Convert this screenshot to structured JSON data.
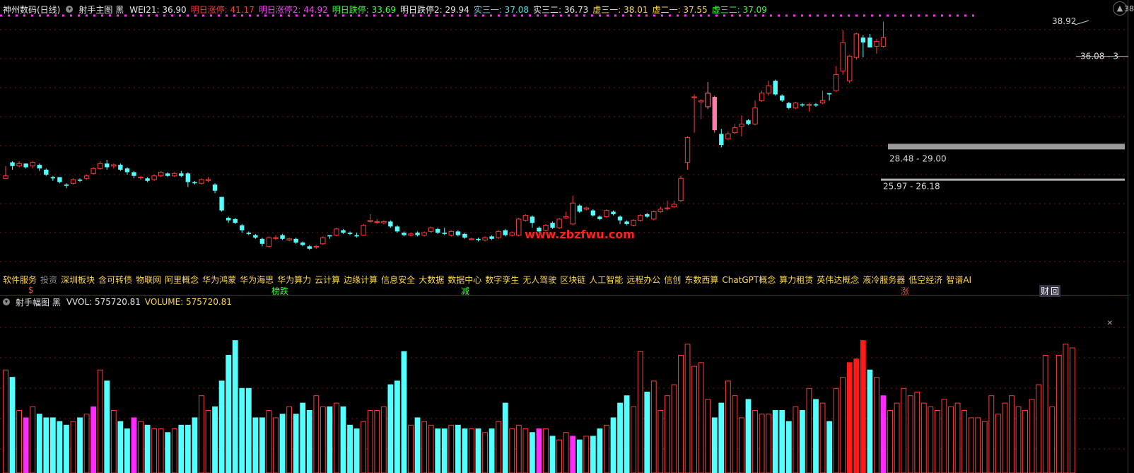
{
  "header": {
    "stock": "神州数码(日线)",
    "indicator": "射手主图 黑",
    "fields": [
      {
        "label": "WEI21: ",
        "value": "36.90",
        "color": "#e8e8e8"
      },
      {
        "label": "明日涨停: ",
        "value": "41.17",
        "color": "#ff3b3b"
      },
      {
        "label": "明日涨停2: ",
        "value": "44.92",
        "color": "#ff3bff"
      },
      {
        "label": "明日跌停: ",
        "value": "33.69",
        "color": "#3bff3b"
      },
      {
        "label": "明日跌停2: ",
        "value": "29.94",
        "color": "#e8e8e8"
      },
      {
        "label": "实三一: ",
        "value": "37.08",
        "color": "#4de0e0"
      },
      {
        "label": "实三二: ",
        "value": "36.73",
        "color": "#e8e8e8"
      },
      {
        "label": "虚三一: ",
        "value": "38.01",
        "color": "#ffd84a"
      },
      {
        "label": "虚二一: ",
        "value": "37.55",
        "color": "#ffd84a"
      },
      {
        "label": "虚三二: ",
        "value": "37.09",
        "color": "#3bff3b"
      }
    ]
  },
  "sub_header": {
    "indicator": "射手幅图 黑",
    "fields": [
      {
        "label": "VVOL: ",
        "value": "575720.81",
        "color": "#e8e8e8"
      },
      {
        "label": "VOLUME: ",
        "value": "575720.81",
        "color": "#ffd84a"
      }
    ]
  },
  "right_axis_label": "38",
  "price_labels": {
    "high": "38.92",
    "last": "36.08 - 3",
    "zone1": "28.48 - 29.00",
    "zone2": "25.97 - 26.18"
  },
  "watermark": "www.zbzfwu.com",
  "concepts": [
    "软件服务",
    "投资",
    "深圳板块",
    "含可转债",
    "物联网",
    "阿里概念",
    "华为鸿蒙",
    "华为海思",
    "华为算力",
    "云计算",
    "边缘计算",
    "信息安全",
    "大数据",
    "数据中心",
    "数字孪生",
    "无人驾驶",
    "区块链",
    "人工智能",
    "远程办公",
    "信创",
    "东数西算",
    "ChatGPT概念",
    "算力租赁",
    "英伟达概念",
    "液冷服务器",
    "低空经济",
    "智谱AI"
  ],
  "events": [
    {
      "label": "$",
      "color": "#ff3b3b"
    },
    {
      "label": "榜跌",
      "color": "#3bff3b"
    },
    {
      "label": "减",
      "color": "#3bff3b"
    },
    {
      "label": "涨",
      "color": "#ff3b3b"
    },
    {
      "label": "财",
      "color": "#ffffff"
    },
    {
      "label": "回",
      "color": "#ffffff"
    }
  ],
  "colors": {
    "up": "#ff3b3b",
    "down": "#54ffff",
    "magenta": "#ff2bff",
    "pink": "#ff7aa8",
    "yellow": "#ffd84a",
    "red_fill": "#ff1a1a"
  },
  "chart_data": [
    {
      "type": "candlestick",
      "title": "神州数码(日线)",
      "candles": [
        [
          26.2,
          26.4,
          26.2,
          27.2
        ],
        [
          27.5,
          27.2,
          26.9,
          27.6
        ],
        [
          27.2,
          27.4,
          27.1,
          27.6
        ],
        [
          27.4,
          27.1,
          27.0,
          27.4
        ],
        [
          27.2,
          27.5,
          27.0,
          27.6
        ],
        [
          27.3,
          27.0,
          26.8,
          27.4
        ],
        [
          26.9,
          26.5,
          26.4,
          27.0
        ],
        [
          26.3,
          26.2,
          26.0,
          26.4
        ],
        [
          26.3,
          25.9,
          25.8,
          26.3
        ],
        [
          25.7,
          25.6,
          25.4,
          25.8
        ],
        [
          25.8,
          26.1,
          25.7,
          26.2
        ],
        [
          26.1,
          26.0,
          25.9,
          26.2
        ],
        [
          26.2,
          26.4,
          26.1,
          26.5
        ],
        [
          26.6,
          27.0,
          26.5,
          27.1
        ],
        [
          27.0,
          27.4,
          26.9,
          27.6
        ],
        [
          27.4,
          27.1,
          26.9,
          27.7
        ],
        [
          27.2,
          27.3,
          27.0,
          27.4
        ],
        [
          27.3,
          26.9,
          26.8,
          27.4
        ],
        [
          27.0,
          26.7,
          26.5,
          27.1
        ],
        [
          26.7,
          26.4,
          26.2,
          26.8
        ],
        [
          26.3,
          26.3,
          26.1,
          26.4
        ],
        [
          26.2,
          26.0,
          25.9,
          26.3
        ],
        [
          26.1,
          26.4,
          26.0,
          26.5
        ],
        [
          26.4,
          26.7,
          26.3,
          26.8
        ],
        [
          26.6,
          26.4,
          26.3,
          26.7
        ],
        [
          26.4,
          26.6,
          26.3,
          26.7
        ],
        [
          26.6,
          26.4,
          26.3,
          26.8
        ],
        [
          26.6,
          25.9,
          25.5,
          26.7
        ],
        [
          25.9,
          25.8,
          25.7,
          26.0
        ],
        [
          25.8,
          26.1,
          25.7,
          26.2
        ],
        [
          26.1,
          26.1,
          25.9,
          26.3
        ],
        [
          25.7,
          25.2,
          25.0,
          25.8
        ],
        [
          24.7,
          23.6,
          23.5,
          24.7
        ],
        [
          23.0,
          22.8,
          22.6,
          23.1
        ],
        [
          22.9,
          22.6,
          22.5,
          23.0
        ],
        [
          22.4,
          22.0,
          21.8,
          22.5
        ],
        [
          21.8,
          21.7,
          21.6,
          21.9
        ],
        [
          21.6,
          21.4,
          21.3,
          21.7
        ],
        [
          21.3,
          20.9,
          20.7,
          21.4
        ],
        [
          20.7,
          21.4,
          20.6,
          21.5
        ],
        [
          21.4,
          21.4,
          21.2,
          21.6
        ],
        [
          21.6,
          21.3,
          21.2,
          21.7
        ],
        [
          21.2,
          21.3,
          21.1,
          21.4
        ],
        [
          21.3,
          21.0,
          20.9,
          21.4
        ],
        [
          21.0,
          20.8,
          20.7,
          21.1
        ],
        [
          20.7,
          20.5,
          20.4,
          20.8
        ],
        [
          20.7,
          20.7,
          20.5,
          20.8
        ],
        [
          20.9,
          21.4,
          20.8,
          21.5
        ],
        [
          21.6,
          21.5,
          21.3,
          21.6
        ],
        [
          21.6,
          22.1,
          21.5,
          22.2
        ],
        [
          22.0,
          21.8,
          21.7,
          22.1
        ],
        [
          21.8,
          21.7,
          21.6,
          21.9
        ],
        [
          21.6,
          21.5,
          21.4,
          21.8
        ],
        [
          21.6,
          22.4,
          21.6,
          22.5
        ],
        [
          22.7,
          22.8,
          22.6,
          23.3
        ],
        [
          22.7,
          22.7,
          22.5,
          22.9
        ],
        [
          22.6,
          22.7,
          22.5,
          22.8
        ],
        [
          22.7,
          22.3,
          22.2,
          22.8
        ],
        [
          22.3,
          21.9,
          21.8,
          22.4
        ],
        [
          21.8,
          21.6,
          21.5,
          21.9
        ],
        [
          21.6,
          21.7,
          21.5,
          21.8
        ],
        [
          21.8,
          21.6,
          21.5,
          21.9
        ],
        [
          21.6,
          21.8,
          21.5,
          21.9
        ],
        [
          21.9,
          22.2,
          21.8,
          22.3
        ],
        [
          22.1,
          21.8,
          21.7,
          22.2
        ],
        [
          21.8,
          21.7,
          21.6,
          22.2
        ],
        [
          21.6,
          21.9,
          21.5,
          22.0
        ],
        [
          21.9,
          21.6,
          21.5,
          22.0
        ],
        [
          21.7,
          21.4,
          21.3,
          21.8
        ],
        [
          21.3,
          21.3,
          21.2,
          21.4
        ],
        [
          21.3,
          21.2,
          21.1,
          21.4
        ],
        [
          21.2,
          21.4,
          21.1,
          21.5
        ],
        [
          21.5,
          21.3,
          21.2,
          21.6
        ],
        [
          21.4,
          21.9,
          21.3,
          22.0
        ],
        [
          22.0,
          21.6,
          21.5,
          22.1
        ],
        [
          21.6,
          21.8,
          21.5,
          21.9
        ],
        [
          21.6,
          22.9,
          21.5,
          23.0
        ],
        [
          22.8,
          23.2,
          22.7,
          23.3
        ],
        [
          23.1,
          22.6,
          22.2,
          23.2
        ],
        [
          22.2,
          21.9,
          21.8,
          22.3
        ],
        [
          22.0,
          22.4,
          21.9,
          22.5
        ],
        [
          22.6,
          22.2,
          22.1,
          22.7
        ],
        [
          22.2,
          22.9,
          22.1,
          23.0
        ],
        [
          23.0,
          23.1,
          22.9,
          23.5
        ],
        [
          22.5,
          24.2,
          22.4,
          24.8
        ],
        [
          24.0,
          23.5,
          23.4,
          24.1
        ],
        [
          23.7,
          23.8,
          23.6,
          23.9
        ],
        [
          23.6,
          23.2,
          23.1,
          23.7
        ],
        [
          23.1,
          22.9,
          22.8,
          23.2
        ],
        [
          23.1,
          23.6,
          23.0,
          23.7
        ],
        [
          23.5,
          23.3,
          23.2,
          23.6
        ],
        [
          23.1,
          22.8,
          22.5,
          23.2
        ],
        [
          22.7,
          22.5,
          22.4,
          22.8
        ],
        [
          22.4,
          22.8,
          22.3,
          22.9
        ],
        [
          22.8,
          23.2,
          22.7,
          23.3
        ],
        [
          23.3,
          23.1,
          23.0,
          23.4
        ],
        [
          22.9,
          23.5,
          22.8,
          23.6
        ],
        [
          23.5,
          23.7,
          23.4,
          23.9
        ],
        [
          23.8,
          23.8,
          23.6,
          24.4
        ],
        [
          23.9,
          24.1,
          23.8,
          24.4
        ],
        [
          24.4,
          26.2,
          24.3,
          26.4
        ],
        [
          27.5,
          29.5,
          26.9,
          29.6
        ],
        [
          32.8,
          32.8,
          29.9,
          33.0
        ],
        [
          32.4,
          32.5,
          31.0,
          32.6
        ],
        [
          32.0,
          33.1,
          31.8,
          34.0
        ],
        [
          32.8,
          30.1,
          29.9,
          32.9
        ],
        [
          29.8,
          28.9,
          28.7,
          30.2
        ],
        [
          29.4,
          29.8,
          29.3,
          30.0
        ],
        [
          29.9,
          30.3,
          29.8,
          30.6
        ],
        [
          30.4,
          30.6,
          29.6,
          31.3
        ],
        [
          30.9,
          30.6,
          30.5,
          31.0
        ],
        [
          30.6,
          31.9,
          30.5,
          32.5
        ],
        [
          32.5,
          33.1,
          32.4,
          33.3
        ],
        [
          33.1,
          33.7,
          32.9,
          34.1
        ],
        [
          34.1,
          33.0,
          32.9,
          34.2
        ],
        [
          32.9,
          32.5,
          32.4,
          33.0
        ],
        [
          32.3,
          31.9,
          31.8,
          32.4
        ],
        [
          31.9,
          32.3,
          31.8,
          32.4
        ],
        [
          32.2,
          32.1,
          32.0,
          32.3
        ],
        [
          32.1,
          32.2,
          31.6,
          32.3
        ],
        [
          32.2,
          32.1,
          32.0,
          32.3
        ],
        [
          32.3,
          32.5,
          32.2,
          33.3
        ],
        [
          33.1,
          33.0,
          32.5,
          33.1
        ],
        [
          33.3,
          34.6,
          33.2,
          35.3
        ],
        [
          34.9,
          37.2,
          34.6,
          38.2
        ],
        [
          34.1,
          36.1,
          33.9,
          36.2
        ],
        [
          36.0,
          37.9,
          35.8,
          38.0
        ],
        [
          37.6,
          37.2,
          36.0,
          37.8
        ],
        [
          37.6,
          36.8,
          36.8,
          37.9
        ],
        [
          36.9,
          37.3,
          36.3,
          37.5
        ],
        [
          36.9,
          37.6,
          36.8,
          38.9
        ]
      ],
      "ylim": [
        19.0,
        39.5
      ]
    },
    {
      "type": "bar",
      "title": "射手幅图 黑",
      "series": [
        {
          "name": "VOLUME",
          "values": [
            28,
            26,
            17,
            15,
            18,
            16,
            15,
            15,
            14,
            13,
            14,
            15,
            16,
            18,
            28,
            25,
            17,
            14,
            12,
            15,
            14,
            13,
            12,
            12,
            11,
            12,
            13,
            13,
            15,
            21,
            17,
            18,
            25,
            32,
            36,
            23,
            23,
            15,
            15,
            17,
            15,
            16,
            18,
            16,
            19,
            17,
            21,
            18,
            18,
            19,
            18,
            13,
            12,
            14,
            17,
            17,
            18,
            24,
            25,
            33,
            13,
            15,
            14,
            13,
            12,
            12,
            13,
            13,
            12,
            12,
            12,
            11,
            12,
            14,
            19,
            12,
            13,
            12,
            11,
            12,
            12,
            10,
            9,
            11,
            10,
            9,
            10,
            10,
            12,
            13,
            15,
            19,
            21,
            18,
            33,
            22,
            25,
            17,
            21,
            24,
            32,
            35,
            29,
            30,
            20,
            15,
            19,
            25,
            21,
            15,
            20,
            17,
            16,
            16,
            17,
            17,
            14,
            18,
            17,
            23,
            20,
            19,
            14,
            23,
            26,
            30,
            31,
            36,
            28,
            26,
            21,
            17,
            19,
            23,
            21,
            22,
            19,
            18,
            17,
            20,
            18,
            19,
            17,
            15,
            15,
            14,
            21,
            16,
            19,
            21,
            18,
            17,
            20,
            24,
            32,
            18,
            32,
            35,
            34
          ]
        }
      ],
      "ylim": [
        0,
        44
      ]
    }
  ]
}
